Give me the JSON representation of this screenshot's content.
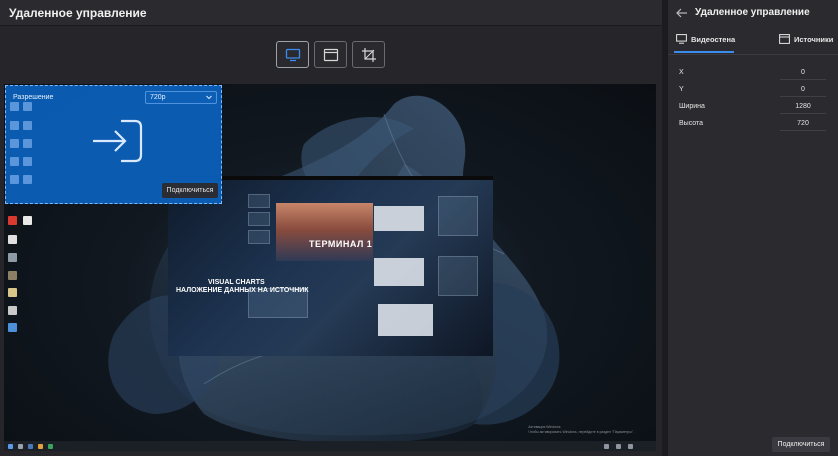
{
  "app": {
    "title": "Удаленное управление"
  },
  "toolbar": {
    "buttons": [
      {
        "icon": "monitor-icon",
        "active": true
      },
      {
        "icon": "window-icon",
        "active": false
      },
      {
        "icon": "crop-icon",
        "active": false
      }
    ]
  },
  "overlay": {
    "resolution_label": "Разрешение",
    "resolution_value": "720p",
    "enter_icon": "enter-icon",
    "connect_label": "Подключиться"
  },
  "video": {
    "title": "ТЕРМИНАЛ 1",
    "subtitle_line1": "VISUAL CHARTS",
    "subtitle_line2": "НАЛОЖЕНИЕ ДАННЫХ НА ИСТОЧНИК"
  },
  "desktop": {
    "watermark_line1": "Активация Windows",
    "watermark_line2": "Чтобы активировать Windows, перейдите в раздел \"Параметры\"."
  },
  "side": {
    "title": "Удаленное управление",
    "back_icon": "arrow-left-icon",
    "tabs": [
      {
        "label": "Видеостена",
        "icon": "monitor-icon",
        "active": true
      },
      {
        "label": "Источники",
        "icon": "window-icon",
        "active": false
      }
    ],
    "fields": [
      {
        "label": "X",
        "value": "0"
      },
      {
        "label": "Y",
        "value": "0"
      },
      {
        "label": "Ширина",
        "value": "1280"
      },
      {
        "label": "Высота",
        "value": "720"
      }
    ],
    "connect_label": "Подключиться"
  },
  "colors": {
    "accent": "#3c8cf0",
    "overlay": "#0b62be",
    "background": "#26262a"
  }
}
